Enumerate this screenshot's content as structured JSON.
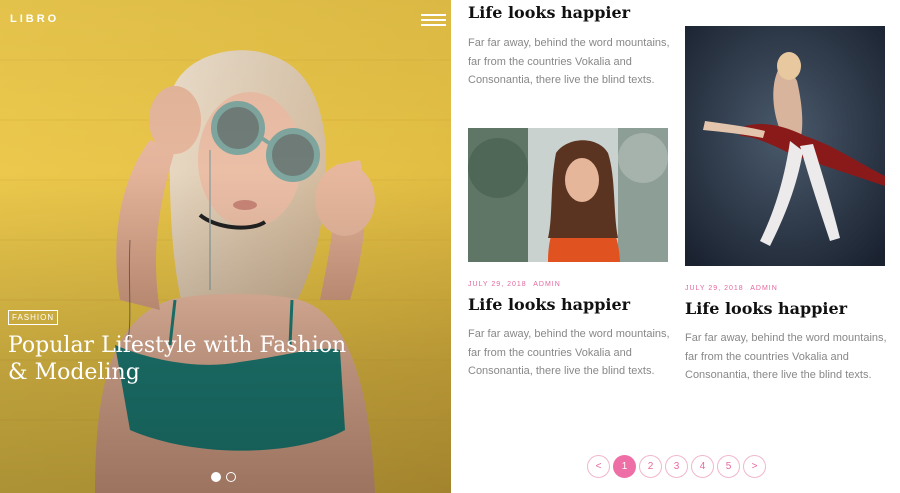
{
  "brand": {
    "logo": "LIBRO",
    "accent_color": "#ee6fa6"
  },
  "header": {
    "menu_icon": "hamburger-icon"
  },
  "hero": {
    "category": "FASHION",
    "title": "Popular Lifestyle with Fashion & Modeling",
    "slides_total": 2,
    "active_slide": 1
  },
  "posts": [
    {
      "title": "Life looks happier",
      "excerpt": "Far far away, behind the word mountains, far from the countries Vokalia and Consonantia, there live the blind texts."
    },
    {
      "date": "JULY 29, 2018",
      "author": "ADMIN",
      "title": "Life looks happier",
      "excerpt": "Far far away, behind the word mountains, far from the countries Vokalia and Consonantia, there live the blind texts."
    },
    {
      "date": "JULY 29, 2018",
      "author": "ADMIN",
      "title": "Life looks happier",
      "excerpt": "Far far away, behind the word mountains, far from the countries Vokalia and Consonantia, there live the blind texts."
    }
  ],
  "pagination": {
    "prev": "<",
    "pages": [
      "1",
      "2",
      "3",
      "4",
      "5"
    ],
    "next": ">",
    "current": "1"
  }
}
